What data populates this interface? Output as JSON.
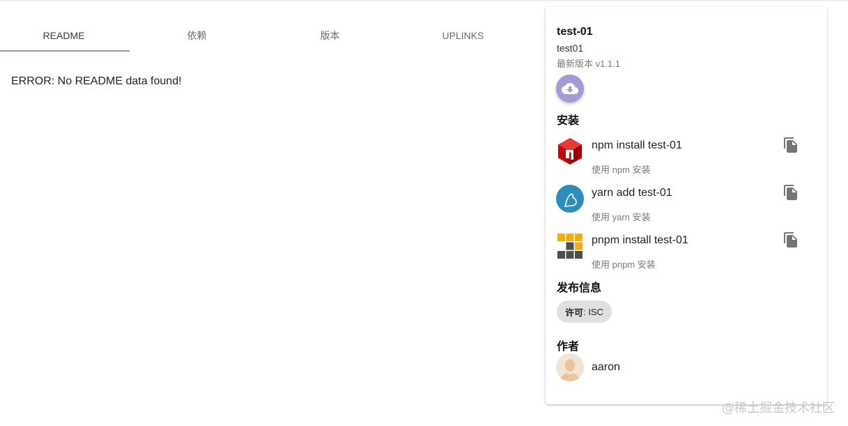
{
  "tabs": [
    {
      "label": "README",
      "active": true
    },
    {
      "label": "依赖",
      "active": false
    },
    {
      "label": "版本",
      "active": false
    },
    {
      "label": "UPLINKS",
      "active": false
    }
  ],
  "readme": {
    "error": "ERROR: No README data found!"
  },
  "package": {
    "name": "test-01",
    "description": "test01",
    "latest_version": "最新版本 v1.1.1"
  },
  "install": {
    "title": "安装",
    "items": [
      {
        "icon": "npm-icon",
        "command": "npm install test-01",
        "hint": "使用 npm 安装"
      },
      {
        "icon": "yarn-icon",
        "command": "yarn add test-01",
        "hint": "使用 yarn 安装"
      },
      {
        "icon": "pnpm-icon",
        "command": "pnpm install test-01",
        "hint": "使用 pnpm 安装"
      }
    ]
  },
  "release": {
    "title": "发布信息",
    "license_label": "许可",
    "license_value": ": ISC"
  },
  "author": {
    "title": "作者",
    "name": "aaron"
  },
  "watermark": "@稀土掘金技术社区",
  "colors": {
    "accent": "#9b8fd1",
    "download_button": "#a39bd3",
    "npm_red": "#cb0000",
    "yarn_blue": "#2c8ebb",
    "pnpm_yellow": "#f9ad00"
  }
}
